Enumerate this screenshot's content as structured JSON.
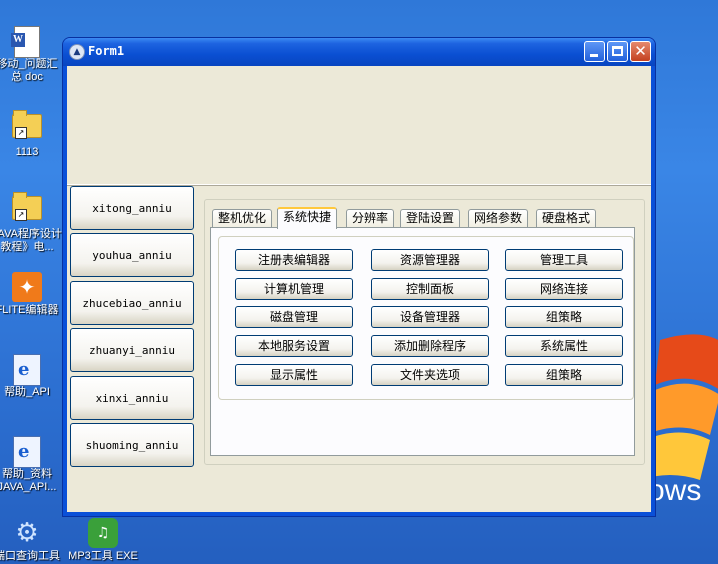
{
  "desktop": {
    "icons": [
      {
        "label_1": "移动_问题汇",
        "label_2": "总 doc",
        "icon": "word-document-icon"
      },
      {
        "label_1": "1113",
        "label_2": "",
        "icon": "folder-icon"
      },
      {
        "label_1": "JAVA程序设计",
        "label_2": "教程》电...",
        "icon": "folder-icon"
      },
      {
        "label_1": "FLITE编辑器",
        "label_2": "",
        "icon": "flash-app-icon"
      },
      {
        "label_1": "帮助_API",
        "label_2": "",
        "icon": "help-file-icon"
      },
      {
        "label_1": "帮助_资料",
        "label_2": "JAVA_API...",
        "icon": "help-file-icon"
      },
      {
        "label_1": "端口查询工具",
        "label_2": "",
        "icon": "gear-app-icon"
      },
      {
        "label_1": "MP3工具 EXE",
        "label_2": "",
        "icon": "mp3-app-icon"
      }
    ],
    "wallpaper_text": "ows"
  },
  "window": {
    "title": "Form1",
    "controls": {
      "minimize": "minimize-icon",
      "maximize": "maximize-icon",
      "close": "✕"
    }
  },
  "side_buttons": [
    "xitong_anniu",
    "youhua_anniu",
    "zhucebiao_anniu",
    "zhuanyi_anniu",
    "xinxi_anniu",
    "shuoming_anniu"
  ],
  "tabs": [
    "整机优化",
    "系统快捷",
    "分辨率",
    "登陆设置",
    "网络参数",
    "硬盘格式"
  ],
  "active_tab": "系统快捷",
  "commands": [
    [
      "注册表编辑器",
      "资源管理器",
      "管理工具"
    ],
    [
      "计算机管理",
      "控制面板",
      "网络连接"
    ],
    [
      "磁盘管理",
      "设备管理器",
      "组策略"
    ],
    [
      "本地服务设置",
      "添加删除程序",
      "系统属性"
    ],
    [
      "显示属性",
      "文件夹选项",
      "组策略"
    ]
  ],
  "colors": {
    "titlebar": "#0a4fd2",
    "client": "#ece9d8",
    "active_tab_accent": "#ffc83c",
    "button_border": "#003c74"
  }
}
